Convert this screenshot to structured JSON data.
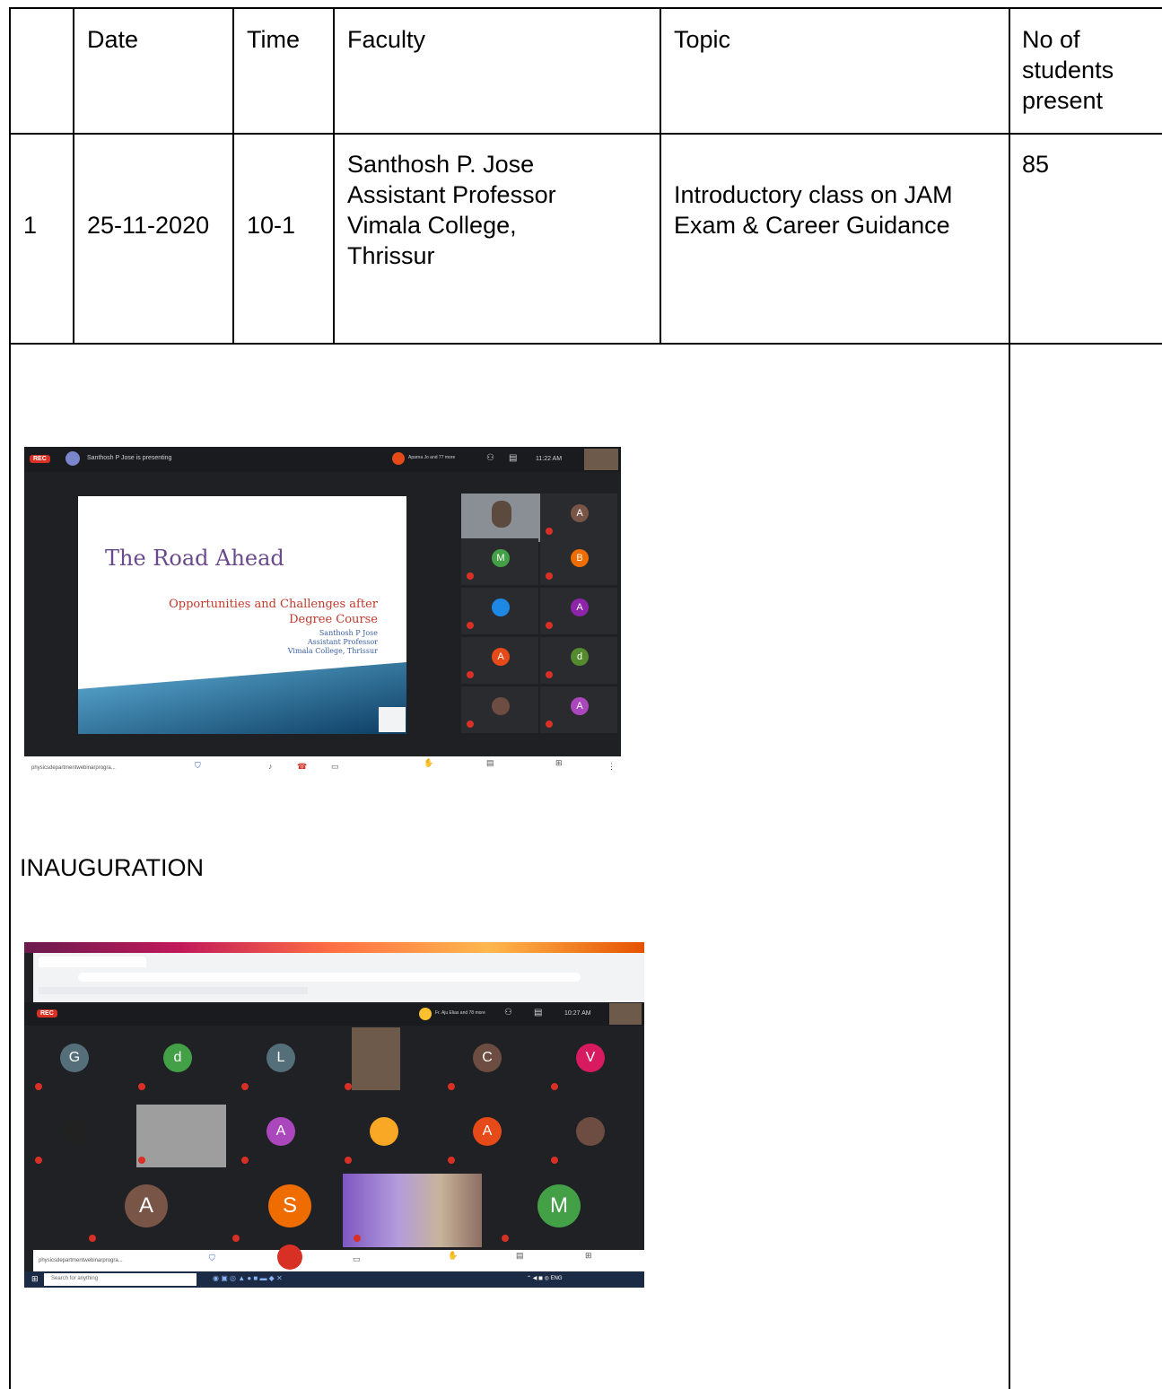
{
  "table": {
    "headers": [
      "",
      "Date",
      "Time",
      "Faculty",
      "Topic",
      "No of students present"
    ],
    "header_lines": {
      "students": [
        "No of",
        "students",
        "present"
      ]
    },
    "row": {
      "sl": "1",
      "date": "25-11-2020",
      "time": "10-1",
      "faculty_lines": [
        "Santhosh P. Jose",
        "Assistant Professor",
        "Vimala College,",
        "Thrissur"
      ],
      "topic_lines": [
        "Introductory class on JAM",
        "Exam & Career Guidance"
      ],
      "students": "85"
    }
  },
  "section_label": "INAUGURATION",
  "screenshot1": {
    "presenter_text": "Santhosh P Jose is presenting",
    "rec_label": "REC",
    "time": "11:22 AM",
    "participants_label": "Aparna Jo and 77 more",
    "slide": {
      "title": "The Road Ahead",
      "subtitle_lines": [
        "Opportunities and Challenges after",
        "Degree Course"
      ],
      "author_lines": [
        "Santhosh P Jose",
        "Assistant Professor",
        "Vimala College, Thrissur"
      ]
    },
    "avatars": [
      {
        "letter": "A",
        "color": "#795548"
      },
      {
        "letter": "M",
        "color": "#43a047"
      },
      {
        "letter": "B",
        "color": "#ef6c00"
      },
      {
        "letter": "",
        "color": "#1e88e5"
      },
      {
        "letter": "A",
        "color": "#8e24aa"
      },
      {
        "letter": "A",
        "color": "#e64a19"
      },
      {
        "letter": "d",
        "color": "#558b2f"
      },
      {
        "letter": "",
        "color": "#6d4c41"
      },
      {
        "letter": "A",
        "color": "#ab47bc"
      }
    ],
    "url_text": "physicsdepartmentwebinarprogra..."
  },
  "screenshot2": {
    "rec_label": "REC",
    "time": "10:27 AM",
    "participants_label": "Fr. Aju Elias and 78 more",
    "avatars_row1": [
      {
        "letter": "G",
        "color": "#546e7a"
      },
      {
        "letter": "d",
        "color": "#43a047"
      },
      {
        "letter": "L",
        "color": "#546e7a"
      },
      {
        "letter": "",
        "color": "#5d4037"
      },
      {
        "letter": "C",
        "color": "#6d4c41"
      },
      {
        "letter": "V",
        "color": "#d81b60"
      }
    ],
    "avatars_row2": [
      {
        "letter": "",
        "color": "#212121"
      },
      {
        "letter": "",
        "color": "#8d6e63"
      },
      {
        "letter": "A",
        "color": "#ab47bc"
      },
      {
        "letter": "",
        "color": "#f9a825"
      },
      {
        "letter": "A",
        "color": "#e64a19"
      },
      {
        "letter": "",
        "color": "#6d4c41"
      }
    ],
    "avatars_row3": [
      {
        "letter": "A",
        "color": "#795548"
      },
      {
        "letter": "S",
        "color": "#ef6c00"
      },
      {
        "letter": "",
        "color": "#7e57c2"
      },
      {
        "letter": "M",
        "color": "#43a047"
      }
    ],
    "url_text": "physicsdepartmentwebinarprogra...",
    "search_text": "Search for anything"
  }
}
